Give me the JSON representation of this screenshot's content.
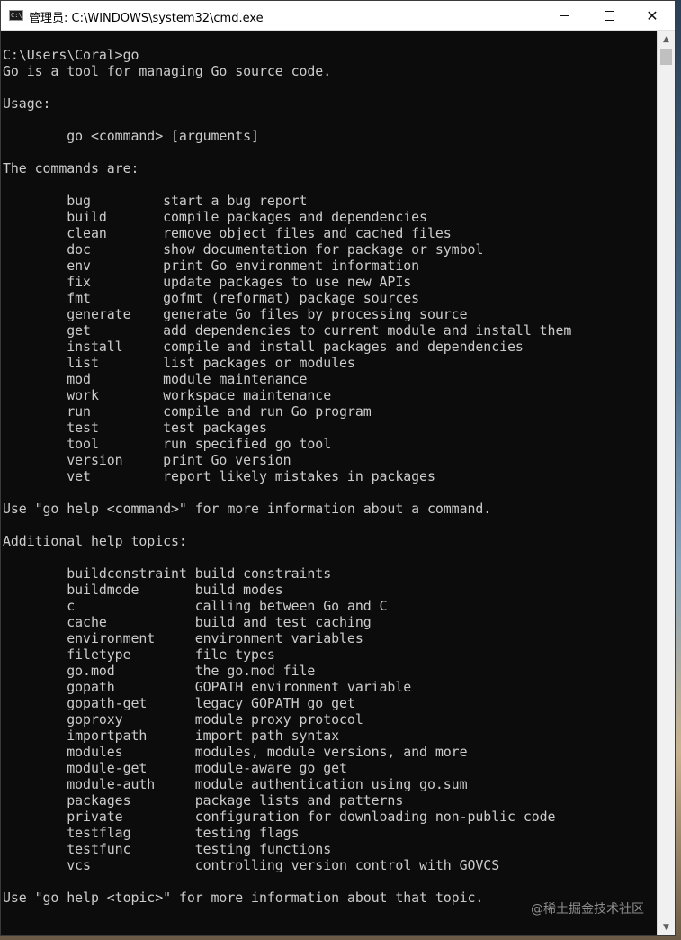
{
  "window": {
    "title": "管理员: C:\\WINDOWS\\system32\\cmd.exe",
    "icon": "cmd-icon",
    "buttons": {
      "minimize": "minimize-icon",
      "maximize": "maximize-icon",
      "close": "close-icon"
    }
  },
  "console": {
    "lines": [
      "C:\\Users\\Coral>go",
      "Go is a tool for managing Go source code.",
      "",
      "Usage:",
      "",
      "        go <command> [arguments]",
      "",
      "The commands are:",
      "",
      "        bug         start a bug report",
      "        build       compile packages and dependencies",
      "        clean       remove object files and cached files",
      "        doc         show documentation for package or symbol",
      "        env         print Go environment information",
      "        fix         update packages to use new APIs",
      "        fmt         gofmt (reformat) package sources",
      "        generate    generate Go files by processing source",
      "        get         add dependencies to current module and install them",
      "        install     compile and install packages and dependencies",
      "        list        list packages or modules",
      "        mod         module maintenance",
      "        work        workspace maintenance",
      "        run         compile and run Go program",
      "        test        test packages",
      "        tool        run specified go tool",
      "        version     print Go version",
      "        vet         report likely mistakes in packages",
      "",
      "Use \"go help <command>\" for more information about a command.",
      "",
      "Additional help topics:",
      "",
      "        buildconstraint build constraints",
      "        buildmode       build modes",
      "        c               calling between Go and C",
      "        cache           build and test caching",
      "        environment     environment variables",
      "        filetype        file types",
      "        go.mod          the go.mod file",
      "        gopath          GOPATH environment variable",
      "        gopath-get      legacy GOPATH go get",
      "        goproxy         module proxy protocol",
      "        importpath      import path syntax",
      "        modules         modules, module versions, and more",
      "        module-get      module-aware go get",
      "        module-auth     module authentication using go.sum",
      "        packages        package lists and patterns",
      "        private         configuration for downloading non-public code",
      "        testflag        testing flags",
      "        testfunc        testing functions",
      "        vcs             controlling version control with GOVCS",
      "",
      "Use \"go help <topic>\" for more information about that topic."
    ]
  },
  "watermark": "@稀土掘金技术社区",
  "colors": {
    "console_bg": "#0c0c0c",
    "console_fg": "#cccccc",
    "titlebar_bg": "#ffffff"
  }
}
